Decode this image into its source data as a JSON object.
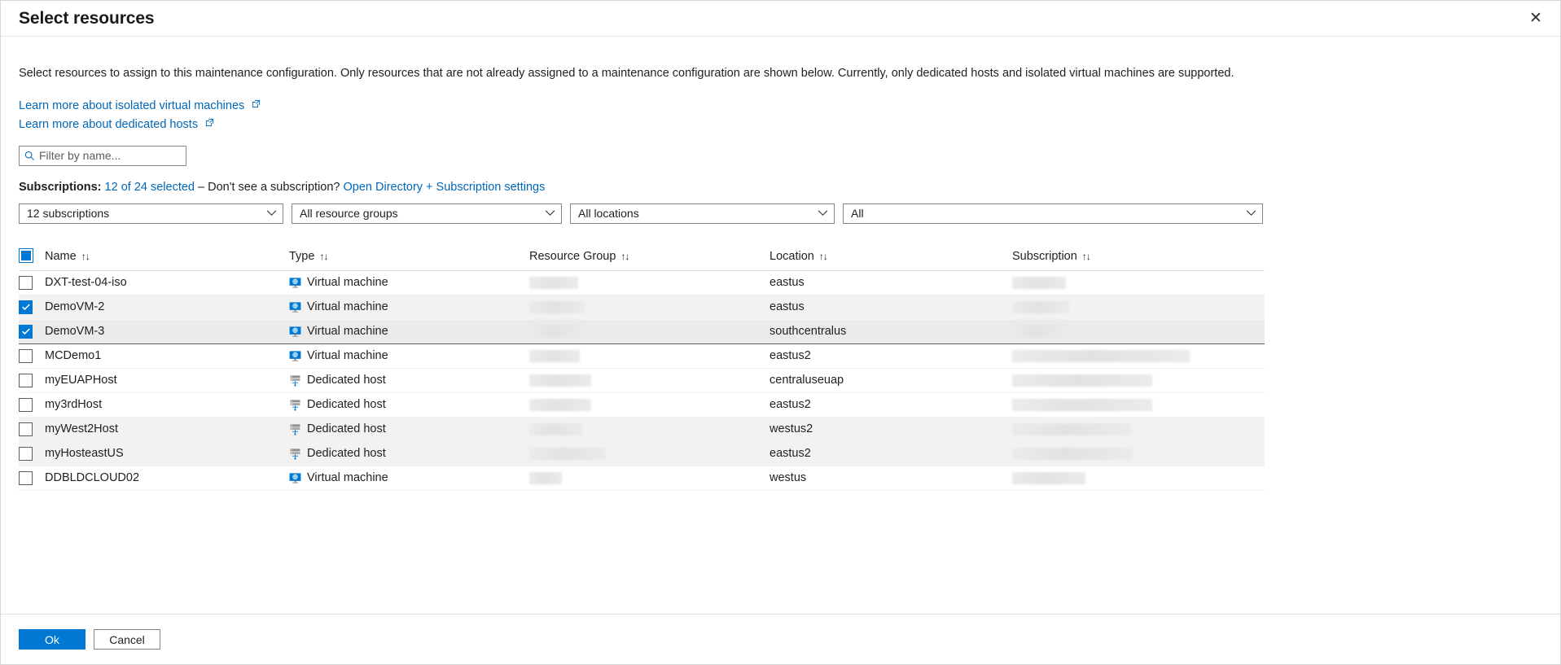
{
  "header": {
    "title": "Select resources",
    "close_label": "✕"
  },
  "intro": {
    "text": "Select resources to assign to this maintenance configuration. Only resources that are not already assigned to a maintenance configuration are shown below. Currently, only dedicated hosts and isolated virtual machines are supported."
  },
  "links": [
    {
      "label": "Learn more about isolated virtual machines",
      "icon": "external-link-icon"
    },
    {
      "label": "Learn more about dedicated hosts",
      "icon": "external-link-icon"
    }
  ],
  "filter": {
    "placeholder": "Filter by name...",
    "value": "",
    "icon": "search-icon"
  },
  "subscriptions_line": {
    "label": "Subscriptions:",
    "selected_link": "12 of 24 selected",
    "separator": " – Don't see a subscription? ",
    "settings_link": "Open Directory + Subscription settings"
  },
  "filters": [
    {
      "name": "subscription-filter",
      "value": "12 subscriptions"
    },
    {
      "name": "resource-group-filter",
      "value": "All resource groups"
    },
    {
      "name": "location-filter",
      "value": "All locations"
    },
    {
      "name": "type-filter",
      "value": "All"
    }
  ],
  "table": {
    "select_all_state": "indeterminate",
    "sort_glyph": "↑↓",
    "columns": [
      {
        "key": "name",
        "label": "Name",
        "sortable": true
      },
      {
        "key": "type",
        "label": "Type",
        "sortable": true
      },
      {
        "key": "resource_group",
        "label": "Resource Group",
        "sortable": true
      },
      {
        "key": "location",
        "label": "Location",
        "sortable": true
      },
      {
        "key": "subscription",
        "label": "Subscription",
        "sortable": true
      }
    ],
    "rows": [
      {
        "name": "DXT-test-04-iso",
        "type": "Virtual machine",
        "type_icon": "virtual-machine-icon",
        "resource_group": "",
        "rg_redacted_width": 60,
        "location": "eastus",
        "subscription": "",
        "sub_redacted_width": 66,
        "selected": false,
        "focused": false,
        "striped": false
      },
      {
        "name": "DemoVM-2",
        "type": "Virtual machine",
        "type_icon": "virtual-machine-icon",
        "resource_group": "",
        "rg_redacted_width": 68,
        "location": "eastus",
        "subscription": "",
        "sub_redacted_width": 70,
        "selected": true,
        "focused": false,
        "striped": true
      },
      {
        "name": "DemoVM-3",
        "type": "Virtual machine",
        "type_icon": "virtual-machine-icon",
        "resource_group": "",
        "rg_redacted_width": 68,
        "location": "southcentralus",
        "subscription": "",
        "sub_redacted_width": 68,
        "selected": true,
        "focused": true,
        "striped": true
      },
      {
        "name": "MCDemo1",
        "type": "Virtual machine",
        "type_icon": "virtual-machine-icon",
        "resource_group": "",
        "rg_redacted_width": 62,
        "location": "eastus2",
        "subscription": "",
        "sub_redacted_width": 218,
        "selected": false,
        "focused": false,
        "striped": false
      },
      {
        "name": "myEUAPHost",
        "type": "Dedicated host",
        "type_icon": "dedicated-host-icon",
        "resource_group": "",
        "rg_redacted_width": 76,
        "location": "centraluseuap",
        "subscription": "",
        "sub_redacted_width": 172,
        "selected": false,
        "focused": false,
        "striped": false
      },
      {
        "name": "my3rdHost",
        "type": "Dedicated host",
        "type_icon": "dedicated-host-icon",
        "resource_group": "",
        "rg_redacted_width": 76,
        "location": "eastus2",
        "subscription": "",
        "sub_redacted_width": 172,
        "selected": false,
        "focused": false,
        "striped": false
      },
      {
        "name": "myWest2Host",
        "type": "Dedicated host",
        "type_icon": "dedicated-host-icon",
        "resource_group": "",
        "rg_redacted_width": 66,
        "location": "westus2",
        "subscription": "",
        "sub_redacted_width": 146,
        "selected": false,
        "focused": false,
        "striped": true
      },
      {
        "name": "myHosteastUS",
        "type": "Dedicated host",
        "type_icon": "dedicated-host-icon",
        "resource_group": "",
        "rg_redacted_width": 94,
        "location": "eastus2",
        "subscription": "",
        "sub_redacted_width": 148,
        "selected": false,
        "focused": false,
        "striped": true
      },
      {
        "name": "DDBLDCLOUD02",
        "type": "Virtual machine",
        "type_icon": "virtual-machine-icon",
        "resource_group": "",
        "rg_redacted_width": 40,
        "location": "westus",
        "subscription": "",
        "sub_redacted_width": 90,
        "selected": false,
        "focused": false,
        "striped": false
      }
    ]
  },
  "footer": {
    "ok_label": "Ok",
    "cancel_label": "Cancel"
  },
  "colors": {
    "accent": "#0078d4",
    "link": "#0067b8",
    "text": "#201f1e",
    "border": "#8a8886",
    "row_alt": "#f3f2f1"
  }
}
